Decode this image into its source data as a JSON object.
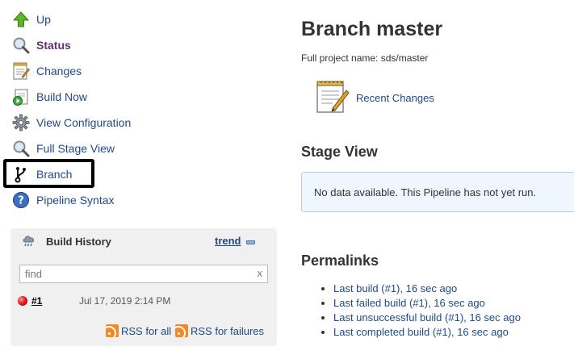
{
  "sidebar": {
    "items": [
      {
        "label": "Up",
        "icon": "up-arrow-icon"
      },
      {
        "label": "Status",
        "icon": "magnifier-icon"
      },
      {
        "label": "Changes",
        "icon": "notepad-icon"
      },
      {
        "label": "Build Now",
        "icon": "build-now-icon"
      },
      {
        "label": "View Configuration",
        "icon": "gear-icon"
      },
      {
        "label": "Full Stage View",
        "icon": "magnifier-icon"
      },
      {
        "label": "Branch",
        "icon": "git-branch-icon"
      },
      {
        "label": "Pipeline Syntax",
        "icon": "help-icon"
      }
    ],
    "current": "Status"
  },
  "build_history": {
    "title": "Build History",
    "trend_label": "trend",
    "search_placeholder": "find",
    "clear_label": "x",
    "builds": [
      {
        "number": "#1",
        "date": "Jul 17, 2019 2:14 PM",
        "status": "failed"
      }
    ],
    "rss_all": "RSS for all",
    "rss_failures": "RSS for failures"
  },
  "main": {
    "title": "Branch master",
    "full_name": "Full project name: sds/master",
    "recent_changes": "Recent Changes",
    "stage_view": {
      "heading": "Stage View",
      "message": "No data available. This Pipeline has not yet run."
    },
    "permalinks": {
      "heading": "Permalinks",
      "links": [
        "Last build (#1), 16 sec ago",
        "Last failed build (#1), 16 sec ago",
        "Last unsuccessful build (#1), 16 sec ago",
        "Last completed build (#1), 16 sec ago"
      ]
    }
  },
  "colors": {
    "link": "#204a87",
    "current_item": "#5c3566",
    "widget_bg": "#f0f0f0",
    "stage_box_bg": "#f0f6fd",
    "failed_ball": "#e02020"
  }
}
